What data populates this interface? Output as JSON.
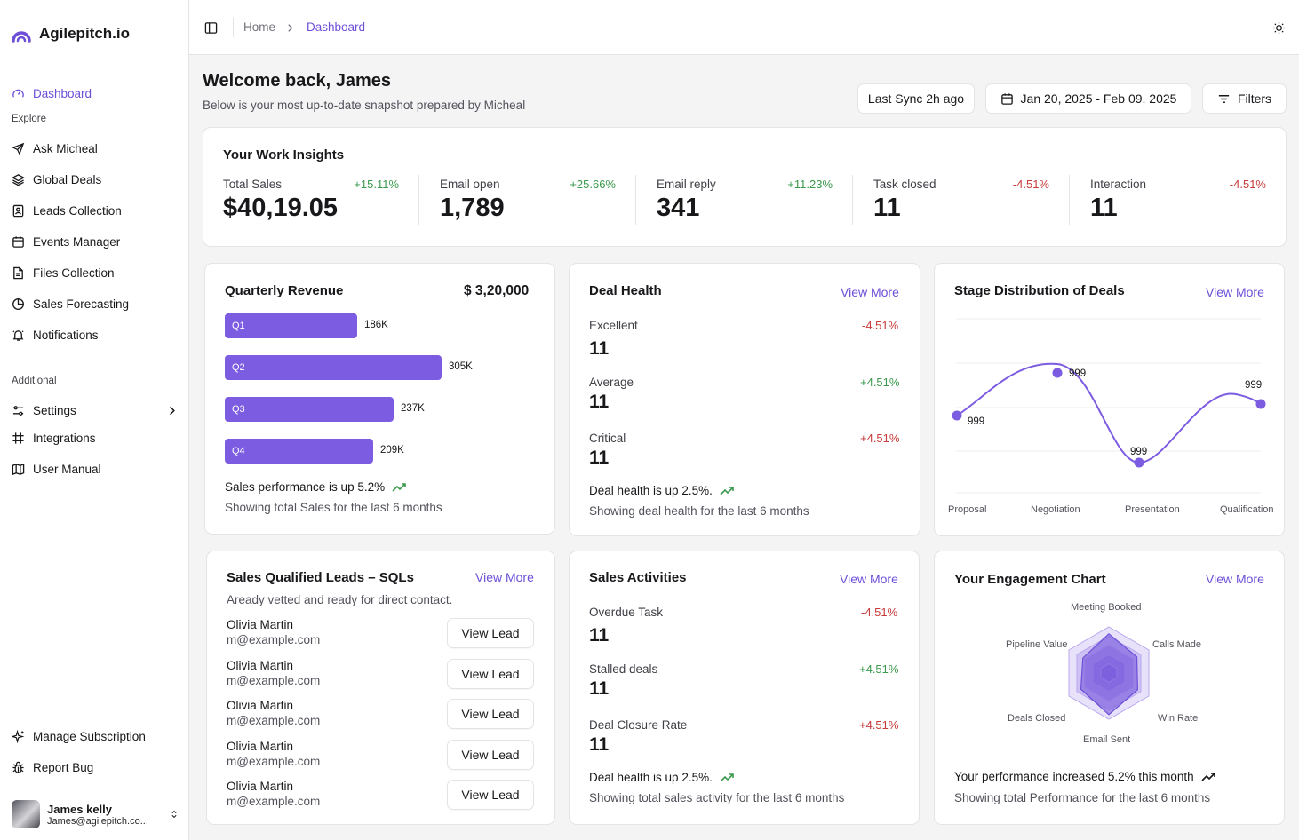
{
  "brand": {
    "name": "Agilepitch.io",
    "accent": "#6d4fd8",
    "positive": "#3b9a4e",
    "negative": "#c73a3a"
  },
  "sidebar": {
    "dashboard": "Dashboard",
    "explore_label": "Explore",
    "explore": [
      "Ask Micheal",
      "Global Deals",
      "Leads Collection",
      "Events Manager",
      "Files Collection",
      "Sales Forecasting",
      "Notifications"
    ],
    "additional_label": "Additional",
    "additional": [
      "Settings",
      "Integrations",
      "User Manual"
    ],
    "bottom": [
      "Manage Subscription",
      "Report Bug"
    ],
    "user": {
      "name": "James kelly",
      "email": "James@agilepitch.co..."
    }
  },
  "topbar": {
    "home": "Home",
    "current": "Dashboard",
    "icons": [
      "sidebar-toggle-icon",
      "theme-sun-icon"
    ]
  },
  "header": {
    "title": "Welcome back, James",
    "subtitle": "Below is your most up-to-date snapshot prepared by Micheal",
    "sync": "Last Sync 2h ago",
    "date_range": "Jan 20, 2025 - Feb 09, 2025",
    "filters": "Filters"
  },
  "insights": {
    "title": "Your Work Insights",
    "kpis": [
      {
        "label": "Total Sales",
        "change": "+15.11%",
        "value": "$40,19.05"
      },
      {
        "label": "Email open",
        "change": "+25.66%",
        "value": "1,789"
      },
      {
        "label": "Email reply",
        "change": "+11.23%",
        "value": "341"
      },
      {
        "label": "Task closed",
        "change": "-4.51%",
        "value": "11"
      },
      {
        "label": "Interaction",
        "change": "-4.51%",
        "value": "11"
      }
    ]
  },
  "quarterly": {
    "title": "Quarterly Revenue",
    "total": "$ 3,20,000",
    "foot_main": "Sales performance is up 5.2%",
    "foot_sub": "Showing total Sales for the last 6 months"
  },
  "deal_health": {
    "title": "Deal Health",
    "view_more": "View More",
    "rows": [
      {
        "label": "Excellent",
        "value": "11",
        "change": "-4.51%"
      },
      {
        "label": "Average",
        "value": "11",
        "change": "+4.51%"
      },
      {
        "label": "Critical",
        "value": "11",
        "change": "+4.51%"
      }
    ],
    "foot_main": "Deal health is up 2.5%.",
    "foot_sub": "Showing deal health for the last 6 months"
  },
  "stage": {
    "title": "Stage Distribution of  Deals",
    "view_more": "View More"
  },
  "sql": {
    "title": "Sales Qualified Leads – SQLs",
    "view_more": "View More",
    "subtitle": "Aready vetted and ready for direct contact.",
    "button": "View Lead",
    "leads": [
      {
        "name": "Olivia Martin",
        "email": "m@example.com"
      },
      {
        "name": "Olivia Martin",
        "email": "m@example.com"
      },
      {
        "name": "Olivia Martin",
        "email": "m@example.com"
      },
      {
        "name": "Olivia Martin",
        "email": "m@example.com"
      },
      {
        "name": "Olivia Martin",
        "email": "m@example.com"
      }
    ]
  },
  "activities": {
    "title": "Sales Activities",
    "view_more": "View More",
    "rows": [
      {
        "label": "Overdue Task",
        "value": "11",
        "change": "-4.51%"
      },
      {
        "label": "Stalled deals",
        "value": "11",
        "change": "+4.51%"
      },
      {
        "label": "Deal Closure Rate",
        "value": "11",
        "change": "+4.51%"
      }
    ],
    "foot_main": "Deal health is up 2.5%.",
    "foot_sub": "Showing total sales activity for the last 6 months"
  },
  "engagement": {
    "title": "Your Engagement  Chart",
    "view_more": "View More",
    "foot_main": "Your performance increased 5.2% this month",
    "foot_sub": "Showing total Performance for the last 6 months"
  },
  "chart_data": [
    {
      "type": "bar",
      "orientation": "horizontal",
      "categories": [
        "Q1",
        "Q2",
        "Q3",
        "Q4"
      ],
      "values": [
        186,
        305,
        237,
        209
      ],
      "labels": [
        "186K",
        "305K",
        "237K",
        "209K"
      ],
      "color": "#7c5ce0"
    },
    {
      "type": "line",
      "smooth": true,
      "categories": [
        "Proposal",
        "Negotiation",
        "Presentation",
        "Qualification"
      ],
      "values": [
        999,
        999,
        999,
        999
      ],
      "labels": [
        "999",
        "999",
        "999",
        "999"
      ],
      "color": "#7c5ce0",
      "grid": true
    },
    {
      "type": "radar",
      "axes": [
        "Meeting Booked",
        "Calls Made",
        "Win Rate",
        "Email Sent",
        "Deals Closed",
        "Pipeline Value"
      ],
      "color": "#7c5ce0"
    }
  ]
}
